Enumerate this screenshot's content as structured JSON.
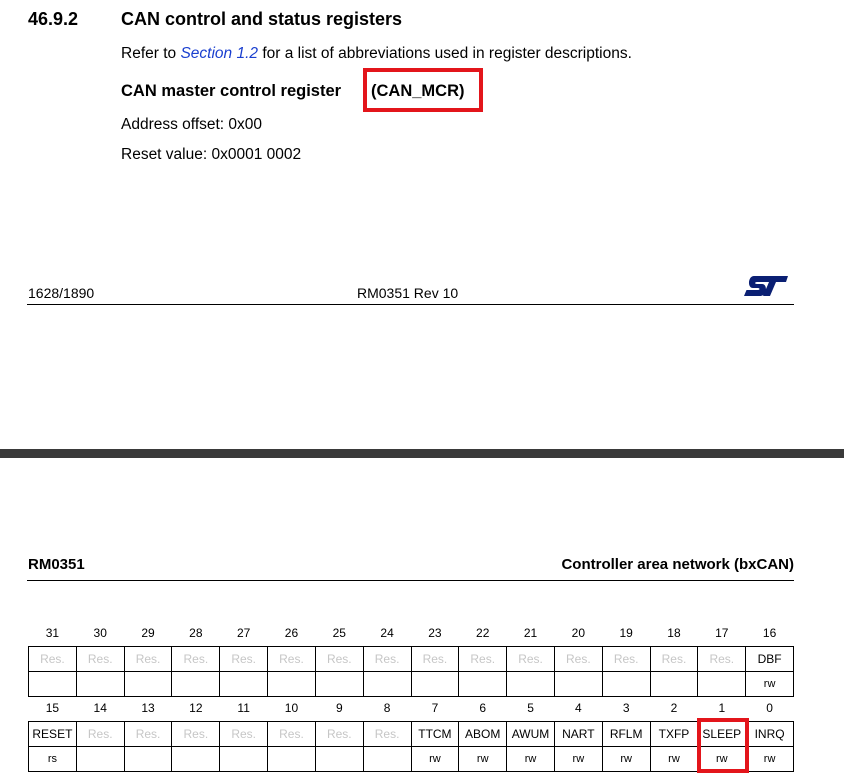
{
  "section": {
    "number": "46.9.2",
    "title": "CAN control and status registers",
    "refer_prefix": "Refer to ",
    "refer_link": "Section 1.2",
    "refer_suffix": " for a list of abbreviations used in register descriptions."
  },
  "register": {
    "title_prefix": "CAN master control register ",
    "title_code": "(CAN_MCR)",
    "address_offset": "Address offset: 0x00",
    "reset_value": "Reset value: 0x0001 0002"
  },
  "footer": {
    "page": "1628/1890",
    "doc": "RM0351 Rev 10",
    "logo_text": "ST"
  },
  "next_header": {
    "left": "RM0351",
    "right": "Controller area network (bxCAN)"
  },
  "reg_table_high": {
    "bits": [
      "31",
      "30",
      "29",
      "28",
      "27",
      "26",
      "25",
      "24",
      "23",
      "22",
      "21",
      "20",
      "19",
      "18",
      "17",
      "16"
    ],
    "names": [
      "Res.",
      "Res.",
      "Res.",
      "Res.",
      "Res.",
      "Res.",
      "Res.",
      "Res.",
      "Res.",
      "Res.",
      "Res.",
      "Res.",
      "Res.",
      "Res.",
      "Res.",
      "DBF"
    ],
    "access": [
      "",
      "",
      "",
      "",
      "",
      "",
      "",
      "",
      "",
      "",
      "",
      "",
      "",
      "",
      "",
      "rw"
    ]
  },
  "reg_table_low": {
    "bits": [
      "15",
      "14",
      "13",
      "12",
      "11",
      "10",
      "9",
      "8",
      "7",
      "6",
      "5",
      "4",
      "3",
      "2",
      "1",
      "0"
    ],
    "names": [
      "RESET",
      "Res.",
      "Res.",
      "Res.",
      "Res.",
      "Res.",
      "Res.",
      "Res.",
      "TTCM",
      "ABOM",
      "AWUM",
      "NART",
      "RFLM",
      "TXFP",
      "SLEEP",
      "INRQ"
    ],
    "access": [
      "rs",
      "",
      "",
      "",
      "",
      "",
      "",
      "",
      "rw",
      "rw",
      "rw",
      "rw",
      "rw",
      "rw",
      "rw",
      "rw"
    ]
  },
  "colors": {
    "highlight": "#e3151b",
    "link": "#1a3fcf",
    "reserved_text": "#c6c6c6",
    "divider": "#3a3a3a"
  }
}
